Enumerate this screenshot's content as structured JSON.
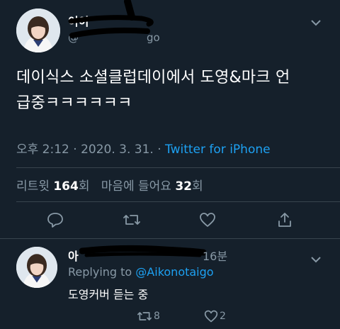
{
  "tweet": {
    "name_visible": "이이",
    "handle_visible": "@",
    "handle_tail": "go",
    "text_line1": "데이식스 소셜클럽데이에서 도영&마크 언",
    "text_line2": "급중ㅋㅋㅋㅋㅋㅋ",
    "time": "오후 2:12",
    "date": "2020. 3. 31.",
    "dot": "·",
    "source": "Twitter for iPhone",
    "retweets_label": "리트윗",
    "retweets_count": "164",
    "retweets_unit": "회",
    "likes_label": "마음에 들어요",
    "likes_count": "32",
    "likes_unit": "회"
  },
  "reply": {
    "name_visible": "아",
    "time_ago": "16분",
    "replying_to_label": "Replying to",
    "replying_to_handle": "@Aikonotaigo",
    "text": "도영커버 듣는 중",
    "retweet_count": "8",
    "like_count": "2"
  },
  "colors": {
    "background": "#15202b",
    "muted": "#8899a6",
    "link": "#1da1f2",
    "divider": "#38444d"
  }
}
